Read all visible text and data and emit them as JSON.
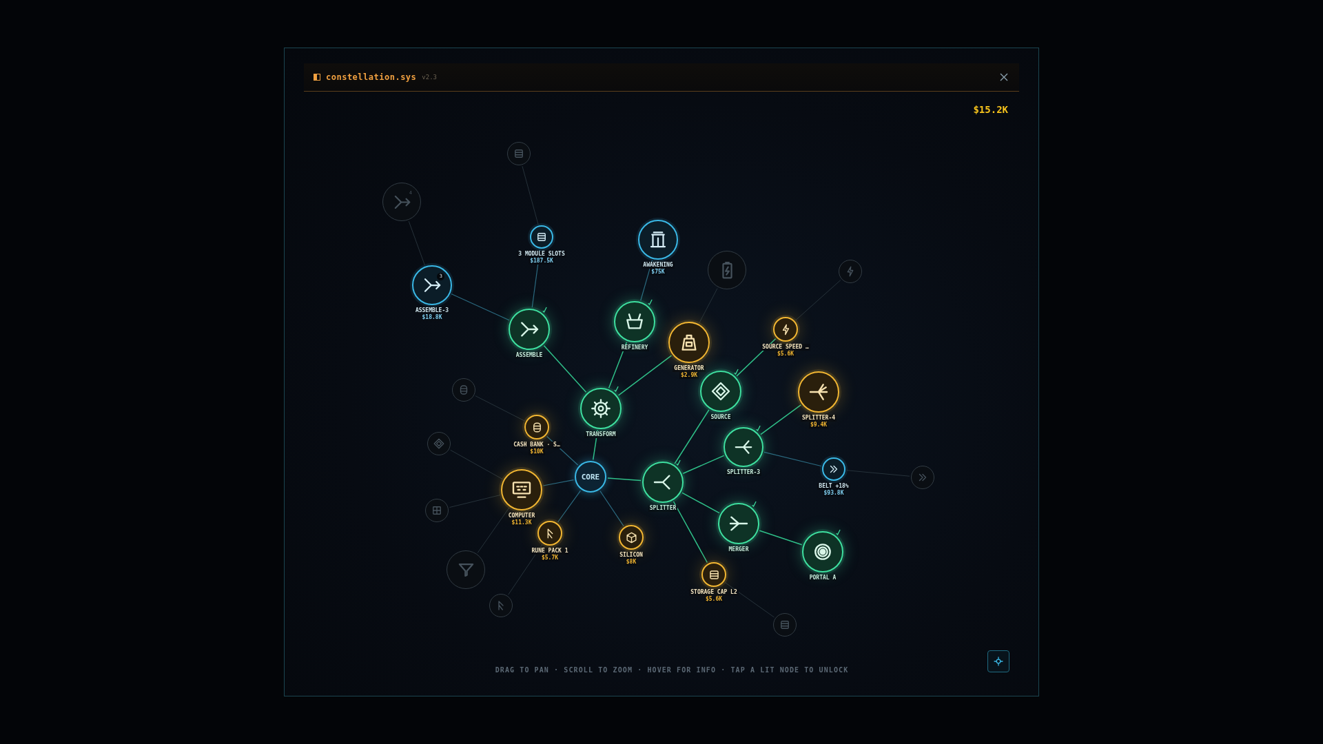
{
  "window": {
    "title": "constellation.sys",
    "version": "v2.3"
  },
  "balance": "$15.2K",
  "tree": {
    "label": "CORE",
    "kind": "core",
    "children": [
      {
        "label": "TRANSFORM",
        "kind": "unlocked",
        "children": [
          {
            "label": "ASSEMBLE",
            "kind": "unlocked",
            "children": [
              {
                "label": "ASSEMBLE-3",
                "price": "$18.8K",
                "kind": "available",
                "badge": "3",
                "children": [
                  {
                    "kind": "locked",
                    "badge": "4"
                  }
                ]
              },
              {
                "label": "3 MODULE SLOTS",
                "price": "$187.5K",
                "kind": "available",
                "children": [
                  {
                    "kind": "locked"
                  }
                ]
              }
            ]
          },
          {
            "label": "REFINERY",
            "kind": "unlocked",
            "children": [
              {
                "label": "AWAKENING",
                "price": "$75K",
                "kind": "available"
              }
            ]
          },
          {
            "label": "GENERATOR",
            "price": "$2.9K",
            "kind": "affordable",
            "children": [
              {
                "kind": "locked"
              }
            ]
          }
        ]
      },
      {
        "label": "SPLITTER",
        "kind": "unlocked",
        "children": [
          {
            "label": "SOURCE",
            "kind": "unlocked",
            "children": [
              {
                "label": "SOURCE SPEED …",
                "price": "$5.6K",
                "kind": "affordable",
                "children": [
                  {
                    "kind": "locked"
                  }
                ]
              }
            ]
          },
          {
            "label": "SPLITTER-3",
            "kind": "unlocked",
            "children": [
              {
                "label": "SPLITTER-4",
                "price": "$9.4K",
                "kind": "affordable"
              },
              {
                "label": "BELT +18%",
                "price": "$93.8K",
                "kind": "available",
                "children": [
                  {
                    "kind": "locked"
                  }
                ]
              }
            ]
          },
          {
            "label": "MERGER",
            "kind": "unlocked",
            "children": [
              {
                "label": "PORTAL A",
                "kind": "unlocked"
              }
            ]
          },
          {
            "label": "STORAGE CAP L2",
            "price": "$5.6K",
            "kind": "affordable",
            "children": [
              {
                "kind": "locked"
              }
            ]
          }
        ]
      },
      {
        "label": "CASH BANK · S…",
        "price": "$10K",
        "kind": "affordable",
        "children": [
          {
            "kind": "locked"
          }
        ]
      },
      {
        "label": "COMPUTER",
        "price": "$11.3K",
        "kind": "affordable",
        "children": [
          {
            "kind": "locked"
          },
          {
            "kind": "locked"
          },
          {
            "kind": "locked"
          }
        ]
      },
      {
        "label": "RUNE PACK 1",
        "price": "$5.7K",
        "kind": "affordable",
        "children": [
          {
            "kind": "locked"
          }
        ]
      },
      {
        "label": "SILICON",
        "price": "$8K",
        "kind": "affordable"
      }
    ]
  },
  "hint": "DRAG TO PAN · SCROLL TO ZOOM · HOVER FOR INFO · TAP A LIT NODE TO UNLOCK"
}
